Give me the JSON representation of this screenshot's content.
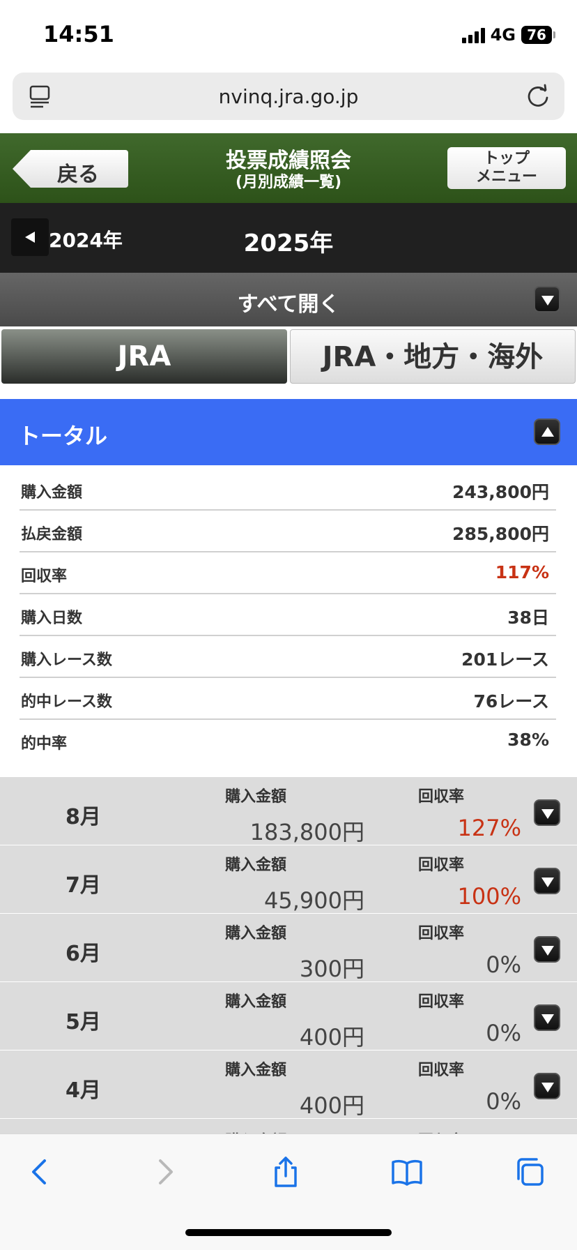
{
  "status_bar": {
    "time": "14:51",
    "network": "4G",
    "battery": "76"
  },
  "address_bar": {
    "url": "nvinq.jra.go.jp"
  },
  "header": {
    "back_label": "戻る",
    "title": "投票成績照会",
    "subtitle": "(月別成績一覧)",
    "top_menu_line1": "トップ",
    "top_menu_line2": "メニュー"
  },
  "year_nav": {
    "prev_year": "2024年",
    "current_year": "2025年"
  },
  "open_all": {
    "label": "すべて開く"
  },
  "tabs": [
    {
      "label": "JRA",
      "active": true
    },
    {
      "label": "JRA・地方・海外",
      "active": false
    }
  ],
  "total": {
    "title": "トータル",
    "rows": [
      {
        "label": "購入金額",
        "value": "243,800円"
      },
      {
        "label": "払戻金額",
        "value": "285,800円"
      },
      {
        "label": "回収率",
        "value": "117%"
      },
      {
        "label": "購入日数",
        "value": "38日"
      },
      {
        "label": "購入レース数",
        "value": "201レース"
      },
      {
        "label": "的中レース数",
        "value": "76レース"
      },
      {
        "label": "的中率",
        "value": "38%"
      }
    ]
  },
  "monthly": {
    "amount_label": "購入金額",
    "rate_label": "回収率",
    "months": [
      {
        "month": "8月",
        "amount": "183,800円",
        "rate": "127%"
      },
      {
        "month": "7月",
        "amount": "45,900円",
        "rate": "100%"
      },
      {
        "month": "6月",
        "amount": "300円",
        "rate": "0%"
      },
      {
        "month": "5月",
        "amount": "400円",
        "rate": "0%"
      },
      {
        "month": "4月",
        "amount": "400円",
        "rate": "0%"
      }
    ]
  },
  "colors": {
    "header_green": "#2d5219",
    "total_blue": "#3a6cf4",
    "highlight_red": "#c83214",
    "ios_blue": "#1a73e8"
  },
  "toolbar_icons": [
    "back-icon",
    "forward-icon",
    "share-icon",
    "bookmarks-icon",
    "tabs-icon"
  ]
}
